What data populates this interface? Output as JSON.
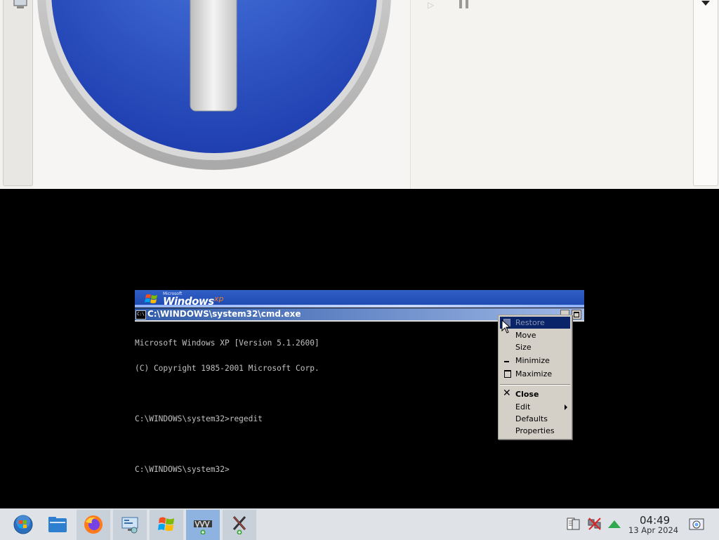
{
  "colors": {
    "xp_banner_blue": "#2f5fc6",
    "cmd_title_start": "#2f5aa8",
    "menu_bg": "#d4d0c8",
    "menu_highlight": "#0a246a",
    "console_text": "#c0c0c0",
    "taskbar_bg": "#dfe3e8"
  },
  "top_window": {
    "left_icon": "monitor-icon",
    "image_icon": "info-icon",
    "media_controls": [
      "play-icon",
      "pause-icon"
    ],
    "right_control": "chevron-down-icon"
  },
  "xp_banner": {
    "brand_small": "Microsoft",
    "brand": "Windows",
    "edition": "xp"
  },
  "cmd_window": {
    "title": "C:\\WINDOWS\\system32\\cmd.exe",
    "icon_text": "C:\\",
    "console_lines": [
      "Microsoft Windows XP [Version 5.1.2600]",
      "(C) Copyright 1985-2001 Microsoft Corp.",
      "",
      "C:\\WINDOWS\\system32>regedit",
      "",
      "C:\\WINDOWS\\system32>"
    ]
  },
  "context_menu": {
    "items": [
      {
        "label": "Restore",
        "icon": "restore-icon",
        "state": "disabled-highlighted"
      },
      {
        "label": "Move",
        "icon": ""
      },
      {
        "label": "Size",
        "icon": ""
      },
      {
        "label": "Minimize",
        "icon": "minimize-icon"
      },
      {
        "label": "Maximize",
        "icon": "maximize-icon"
      },
      {
        "label": "Close",
        "icon": "close-icon",
        "bold": true
      },
      {
        "label": "Edit",
        "icon": "submenu-arrow-icon"
      },
      {
        "label": "Defaults",
        "icon": ""
      },
      {
        "label": "Properties",
        "icon": ""
      }
    ]
  },
  "taskbar": {
    "buttons": [
      {
        "name": "start-menu",
        "icon": "windows-orb-icon"
      },
      {
        "name": "file-manager",
        "icon": "folder-icon"
      },
      {
        "name": "firefox",
        "icon": "firefox-icon"
      },
      {
        "name": "system-monitor",
        "icon": "network-computer-icon"
      },
      {
        "name": "windows-xp-vm",
        "icon": "windows-flag-icon"
      },
      {
        "name": "virtualbox-app",
        "icon": "vm-icon"
      },
      {
        "name": "x-app",
        "icon": "x-icon"
      }
    ],
    "tray": {
      "icons": [
        "clipboard-icon",
        "network-disconnected-icon",
        "update-arrow-icon",
        "screenshot-icon"
      ],
      "time": "04:49",
      "date": "13 Apr 2024"
    }
  }
}
